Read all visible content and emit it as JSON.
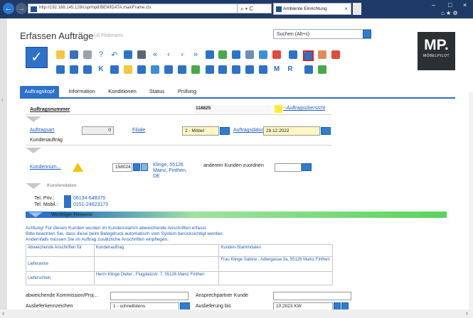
{
  "browser": {
    "url": "http://192.168.145.128/csp/mp8/BEWIDATA.mainFrame.cls",
    "search_glyph": "⌕ ▾ C",
    "tab_title": "Ambiente Einrichtung",
    "tab_close": "×",
    "window_controls": [
      "–",
      "□",
      "×"
    ],
    "toolbar_icons": "⌂ ★ ⚙"
  },
  "page": {
    "title": "Erfassen Aufträge",
    "user": "Uli Flottmann",
    "search_placeholder": "Suchen (Alt+s)"
  },
  "logo": {
    "big": "MP.",
    "small": "MÖBELPILOT"
  },
  "tabs": [
    {
      "label": "Auftragskopf"
    },
    {
      "label": "Information"
    },
    {
      "label": "Konditionen"
    },
    {
      "label": "Status"
    },
    {
      "label": "Prüfung"
    }
  ],
  "form": {
    "auftragsnummer_label": "Auftragsnummer",
    "auftragsnummer_value": "118825",
    "uebersicht_link": "--Auftragsübersicht",
    "auftragsart_label": "Auftragsart",
    "auftragsart_value": "0",
    "auftragsart_text": "Kundenauftrag",
    "filiale_label": "Filiale",
    "filiale_value": "2 - Möbel",
    "auftragsdatum_label": "Auftragsdatum",
    "auftragsdatum_value": "29.12.2022",
    "kundennummer_label": "Kundennum...",
    "kundennummer_value": "158024",
    "kunde_name": "Klinge, 55126",
    "kunde_ort": "Mainz, Finthen,",
    "kunde_land": "DE",
    "anderem_kunden_label": "anderem Kunden zuordnen",
    "kundendaten_label": "Kundendaten",
    "tel_priv_label": "Tel. Priv.:",
    "tel_priv_value": "06134-648375",
    "tel_mobil_label": "Tel. Mobil.:",
    "tel_mobil_value": "0151-24623173",
    "hinweis_label": "Wichtiger Hinweis!",
    "hinweis_lines": [
      "Achtung! Für diesen Kunden wurden im Kundenstamm abweichende Anschriften erfasst.",
      "Bitte beachten Sie, dass diese beim Belegdruck automatisch vom System berücksichtigt werden.",
      "Andernfalls müssen Sie im Auftrag zusätzliche Anschriften einpflegen."
    ],
    "table": {
      "headers": [
        "Abweichende Anschriften für",
        "Kundenauftrag",
        "Kunden-Stammdaten"
      ],
      "rows": [
        [
          "Lieferavise",
          "",
          "Frau Klinge Sabine , Adlergasse 3a, 55126 Mainz Finthen"
        ],
        [
          "Lieferschein",
          "Herrn Klinge Dieter , Flugplatzstr. 7, 55126 Mainz Finthen",
          ""
        ]
      ]
    },
    "kommission_label": "abweichende Kommission/Proj...",
    "ansprechpartner_label": "Ansprechpartner Kunde",
    "auslieferkennzeichen_label": "Auslieferkennzeichen",
    "auslieferkennzeichen_value": "1 - schnellstens",
    "auslieferung_label": "Auslieferung bis",
    "auslieferung_value": "10.2023 KW"
  }
}
